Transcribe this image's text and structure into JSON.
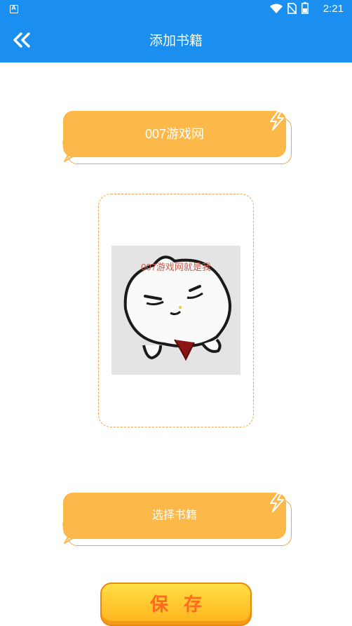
{
  "status_bar": {
    "time": "2:21",
    "app_badge": "A",
    "icons": [
      "wifi-icon",
      "no-sim-icon",
      "battery-icon"
    ]
  },
  "header": {
    "title": "添加书籍",
    "back_icon": "double-chevron-left-icon"
  },
  "book_name_tag": {
    "label": "007游戏网"
  },
  "cover": {
    "caption": "007游戏网就是我"
  },
  "select_book_tag": {
    "label": "选择书籍"
  },
  "save_button": {
    "label": "保存"
  },
  "colors": {
    "primary": "#1b8fef",
    "tag": "#fdb84a",
    "tag_border": "#f7a43b",
    "save_text": "#ff6a1f"
  }
}
